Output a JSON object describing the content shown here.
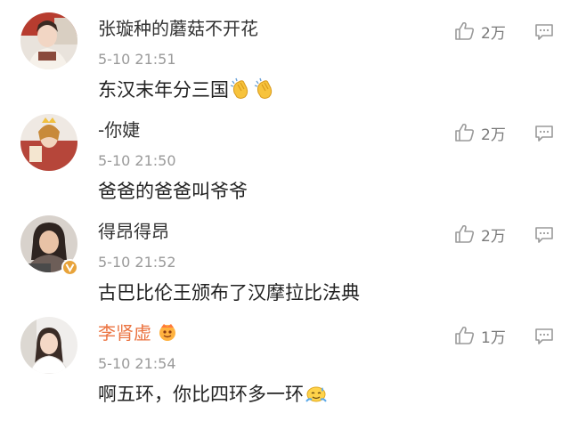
{
  "comments": [
    {
      "username": "张璇种的蘑菇不开花",
      "timestamp": "5-10 21:51",
      "text": "东汉末年分三国",
      "likes": "2万",
      "emoji": [
        "clapping-hands",
        "clapping-hands"
      ],
      "verified": false,
      "vip": false
    },
    {
      "username": "-你婕",
      "timestamp": "5-10 21:50",
      "text": "爸爸的爸爸叫爷爷",
      "likes": "2万",
      "emoji": [],
      "verified": false,
      "vip": false
    },
    {
      "username": "得昂得昂",
      "timestamp": "5-10 21:52",
      "text": "古巴比伦王颁布了汉摩拉比法典",
      "likes": "2万",
      "emoji": [],
      "verified": true,
      "vip": false
    },
    {
      "username": "李肾虚",
      "timestamp": "5-10 21:54",
      "text": "啊五环，你比四环多一环",
      "likes": "1万",
      "emoji": [
        "sweat-smile-face"
      ],
      "verified": false,
      "vip": true
    }
  ],
  "colors": {
    "vip_name": "#eb7340",
    "timestamp": "#9a9a9a",
    "icon": "#9a9a9a",
    "verified_badge": "#e8a33a"
  },
  "icons": {
    "like": "thumbs-up-icon",
    "reply": "comment-bubble-icon",
    "verified": "verified-v-badge-icon",
    "member": "member-crown-badge-icon"
  }
}
